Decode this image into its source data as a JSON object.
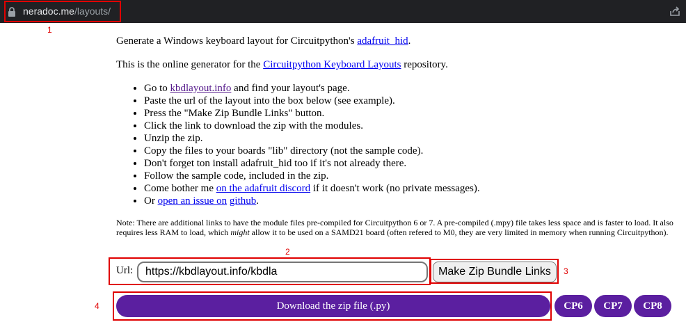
{
  "browser": {
    "host": "neradoc.me",
    "path": "/layouts/",
    "icons": [
      "lock-icon",
      "share-icon"
    ]
  },
  "annotations": [
    "1",
    "2",
    "3",
    "4"
  ],
  "intro": {
    "line1_prefix": "Generate a Windows keyboard layout for Circuitpython's ",
    "line1_link": "adafruit_hid",
    "line1_suffix": ".",
    "line2_prefix": "This is the online generator for the ",
    "line2_link": "Circuitpython Keyboard Layouts",
    "line2_suffix": " repository."
  },
  "steps": {
    "s1_prefix": "Go to ",
    "s1_link": "kbdlayout.info",
    "s1_suffix": " and find your layout's page.",
    "s2": "Paste the url of the layout into the box below (see example).",
    "s3": "Press the \"Make Zip Bundle Links\" button.",
    "s4": "Click the link to download the zip with the modules.",
    "s5": "Unzip the zip.",
    "s6": "Copy the files to your boards \"lib\" directory (not the sample code).",
    "s7": "Don't forget ton install adafruit_hid too if it's not already there.",
    "s8": "Follow the sample code, included in the zip.",
    "s9_prefix": "Come bother me ",
    "s9_link": "on the adafruit discord",
    "s9_suffix": " if it doesn't work (no private messages).",
    "s10_prefix": "Or ",
    "s10_link_a": "open an issue on",
    "s10_space": " ",
    "s10_link_b": "github",
    "s10_suffix": "."
  },
  "note": {
    "part1": "Note: There are additional links to have the module files pre-compiled for Circuitpython 6 or 7. A pre-compiled (.mpy) file takes less space and is faster to load. It also requires less RAM to load, which ",
    "emph": "might",
    "part2": " allow it to be used on a SAMD21 board (often refered to M0, they are very limited in memory when running Circuitpython)."
  },
  "form": {
    "url_label": "Url:",
    "url_value": "https://kbdlayout.info/kbdla",
    "make_button": "Make Zip Bundle Links"
  },
  "downloads": {
    "main": "Download the zip file (.py)",
    "cp6": "CP6",
    "cp7": "CP7",
    "cp8": "CP8"
  },
  "colors": {
    "accent": "#5b1fa0",
    "annotation": "#e00000"
  }
}
